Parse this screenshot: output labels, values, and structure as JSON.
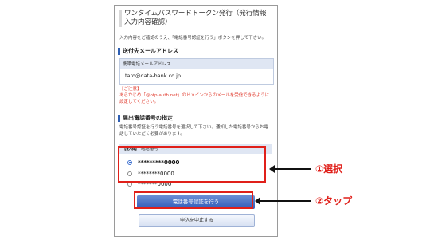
{
  "screen": {
    "title": "ワンタイムパスワードトークン発行（発行情報入力内容確認）",
    "desc": "入力内容をご確認のうえ、「電話番号認証を行う」ボタンを押して下さい。"
  },
  "email": {
    "section": "送付先メールアドレス",
    "field_label": "携帯電話メールアドレス",
    "value": "taro@data-bank.co.jp"
  },
  "caution": {
    "heading": "【ご注意】",
    "text": "あらかじめ「@otp-auth.net」のドメインからのメールを受信できるように設定してください。"
  },
  "tel": {
    "section": "届出電話番号の指定",
    "desc": "電話番号認証を行う電話番号を選択して下さい。通知した電話番号からお電話していただく必要があります。",
    "required_tag": "【必須】",
    "field_label": "電話番号",
    "options": [
      "*********0000",
      "********0000",
      "*******0000"
    ]
  },
  "buttons": {
    "auth": "電話番号認証を行う",
    "cancel": "申込を中止する"
  },
  "annotations": {
    "select": "①選択",
    "tap": "②タップ"
  },
  "colors": {
    "highlight": "#e0201a",
    "accent": "#2f5ab8"
  }
}
